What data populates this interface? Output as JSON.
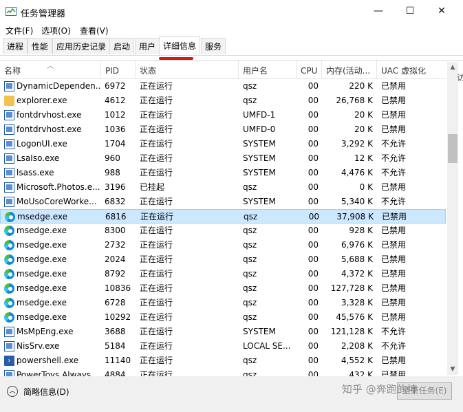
{
  "window": {
    "title": "任务管理器",
    "minimize": "—",
    "maximize": "☐",
    "close": "✕"
  },
  "menu": [
    "文件(F)",
    "选项(O)",
    "查看(V)"
  ],
  "tabs": [
    "进程",
    "性能",
    "应用历史记录",
    "启动",
    "用户",
    "详细信息",
    "服务"
  ],
  "active_tab": "详细信息",
  "columns": [
    "名称",
    "PID",
    "状态",
    "用户名",
    "CPU",
    "内存(活动...",
    "UAC 虚拟化"
  ],
  "rows": [
    {
      "icon": "window-app-icon",
      "name": "DynamicDependen...",
      "pid": "6972",
      "status": "正在运行",
      "user": "qsz",
      "cpu": "00",
      "mem": "220 K",
      "uac": "已禁用"
    },
    {
      "icon": "folder-icon",
      "name": "explorer.exe",
      "pid": "4612",
      "status": "正在运行",
      "user": "qsz",
      "cpu": "00",
      "mem": "26,768 K",
      "uac": "已禁用"
    },
    {
      "icon": "window-app-icon",
      "name": "fontdrvhost.exe",
      "pid": "1012",
      "status": "正在运行",
      "user": "UMFD-1",
      "cpu": "00",
      "mem": "20 K",
      "uac": "已禁用"
    },
    {
      "icon": "window-app-icon",
      "name": "fontdrvhost.exe",
      "pid": "1036",
      "status": "正在运行",
      "user": "UMFD-0",
      "cpu": "00",
      "mem": "20 K",
      "uac": "已禁用"
    },
    {
      "icon": "window-app-icon",
      "name": "LogonUI.exe",
      "pid": "1704",
      "status": "正在运行",
      "user": "SYSTEM",
      "cpu": "00",
      "mem": "3,292 K",
      "uac": "不允许"
    },
    {
      "icon": "window-app-icon",
      "name": "LsaIso.exe",
      "pid": "960",
      "status": "正在运行",
      "user": "SYSTEM",
      "cpu": "00",
      "mem": "12 K",
      "uac": "不允许"
    },
    {
      "icon": "window-app-icon",
      "name": "lsass.exe",
      "pid": "988",
      "status": "正在运行",
      "user": "SYSTEM",
      "cpu": "00",
      "mem": "4,476 K",
      "uac": "不允许"
    },
    {
      "icon": "window-app-icon",
      "name": "Microsoft.Photos.e...",
      "pid": "3196",
      "status": "已挂起",
      "user": "qsz",
      "cpu": "00",
      "mem": "0 K",
      "uac": "已禁用"
    },
    {
      "icon": "window-app-icon",
      "name": "MoUsoCoreWorke...",
      "pid": "6832",
      "status": "正在运行",
      "user": "SYSTEM",
      "cpu": "00",
      "mem": "5,340 K",
      "uac": "不允许"
    },
    {
      "icon": "edge-icon",
      "name": "msedge.exe",
      "pid": "6816",
      "status": "正在运行",
      "user": "qsz",
      "cpu": "00",
      "mem": "37,908 K",
      "uac": "已禁用",
      "selected": true
    },
    {
      "icon": "edge-icon",
      "name": "msedge.exe",
      "pid": "8300",
      "status": "正在运行",
      "user": "qsz",
      "cpu": "00",
      "mem": "928 K",
      "uac": "已禁用"
    },
    {
      "icon": "edge-icon",
      "name": "msedge.exe",
      "pid": "2732",
      "status": "正在运行",
      "user": "qsz",
      "cpu": "00",
      "mem": "6,976 K",
      "uac": "已禁用"
    },
    {
      "icon": "edge-icon",
      "name": "msedge.exe",
      "pid": "2024",
      "status": "正在运行",
      "user": "qsz",
      "cpu": "00",
      "mem": "5,688 K",
      "uac": "已禁用"
    },
    {
      "icon": "edge-icon",
      "name": "msedge.exe",
      "pid": "8792",
      "status": "正在运行",
      "user": "qsz",
      "cpu": "00",
      "mem": "4,372 K",
      "uac": "已禁用"
    },
    {
      "icon": "edge-icon",
      "name": "msedge.exe",
      "pid": "10836",
      "status": "正在运行",
      "user": "qsz",
      "cpu": "00",
      "mem": "127,728 K",
      "uac": "已禁用"
    },
    {
      "icon": "edge-icon",
      "name": "msedge.exe",
      "pid": "6728",
      "status": "正在运行",
      "user": "qsz",
      "cpu": "00",
      "mem": "3,328 K",
      "uac": "已禁用"
    },
    {
      "icon": "edge-icon",
      "name": "msedge.exe",
      "pid": "10292",
      "status": "正在运行",
      "user": "qsz",
      "cpu": "00",
      "mem": "45,576 K",
      "uac": "已禁用"
    },
    {
      "icon": "window-app-icon",
      "name": "MsMpEng.exe",
      "pid": "3688",
      "status": "正在运行",
      "user": "SYSTEM",
      "cpu": "00",
      "mem": "121,128 K",
      "uac": "不允许"
    },
    {
      "icon": "window-app-icon",
      "name": "NisSrv.exe",
      "pid": "5184",
      "status": "正在运行",
      "user": "LOCAL SE...",
      "cpu": "00",
      "mem": "2,208 K",
      "uac": "不允许"
    },
    {
      "icon": "powershell-icon",
      "name": "powershell.exe",
      "pid": "11140",
      "status": "正在运行",
      "user": "qsz",
      "cpu": "00",
      "mem": "4,552 K",
      "uac": "已禁用"
    },
    {
      "icon": "window-app-icon",
      "name": "PowerToys.Always...",
      "pid": "4884",
      "status": "正在运行",
      "user": "qsz",
      "cpu": "00",
      "mem": "432 K",
      "uac": "已禁用"
    }
  ],
  "footer": {
    "fewer_details": "简略信息(D)",
    "end_task": "结束任务(E)"
  },
  "watermark": "知乎 @奔跑的坤",
  "side_peek": "访"
}
